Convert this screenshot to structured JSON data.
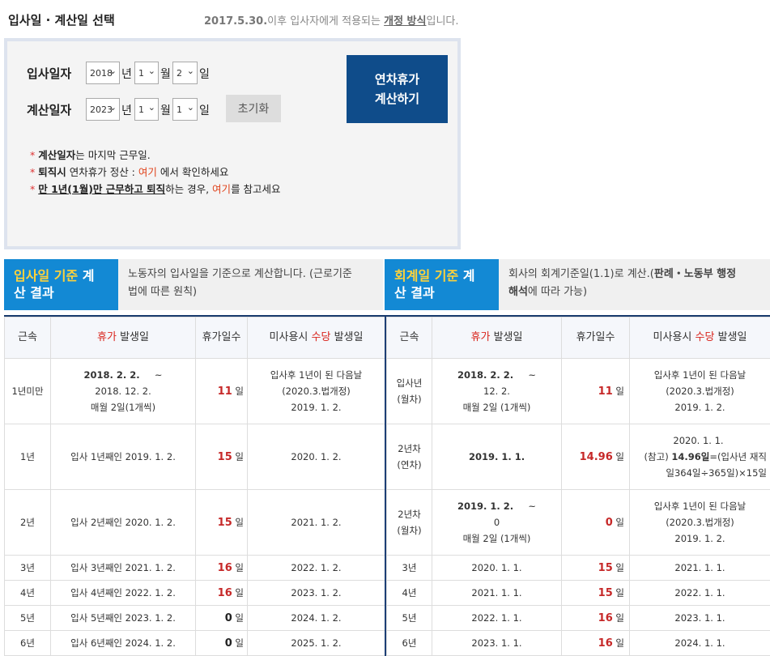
{
  "header": {
    "title": "입사일 · 계산일 선택",
    "notice_date": "2017.5.30.",
    "notice_mid": "이후 입사자에게 적용되는 ",
    "notice_link": "개정 방식",
    "notice_end": "입니다."
  },
  "form": {
    "hire_label": "입사일자",
    "calc_label": "계산일자",
    "hire": {
      "year": "2018",
      "month": "1",
      "day": "2"
    },
    "calc": {
      "year": "2023",
      "month": "1",
      "day": "1"
    },
    "unit_year": "년",
    "unit_month": "월",
    "unit_day": "일",
    "reset_label": "초기화",
    "calc_button_line1": "연차휴가",
    "calc_button_line2": "계산하기"
  },
  "notes": {
    "n1_bold": "계산일자",
    "n1_rest": "는 마지막 근무일.",
    "n2_bold": "퇴직시",
    "n2_mid": " 연차휴가 정산 : ",
    "n2_link": "여기",
    "n2_end": " 에서 확인하세요",
    "n3_bold": "만 1년(1월)만 근무하고 퇴직",
    "n3_mid": "하는 경우, ",
    "n3_link": "여기",
    "n3_end": "를 참고세요"
  },
  "tabs": {
    "left_line1_y": "입사일 기준",
    "left_line1_w": " 계",
    "left_line2": "산 결과",
    "left_desc1": "노동자의 입사일을 기준으로 계산합니다. (근로기준",
    "left_desc2": "법에 따른 원칙)",
    "right_line1_y": "회계일 기준",
    "right_line1_w": " 계",
    "right_line2": "산 결과",
    "right_desc1": "회사의 회계기준일(1.1)로 계산.(",
    "right_desc1_bold": "판례・노동부 행정",
    "right_desc2_bold": "해석",
    "right_desc2": "에 따라 가능)"
  },
  "table_headers": {
    "tenure": "근속",
    "leave_red": "휴가",
    "leave_rest": " 발생일",
    "days": "휴가일수",
    "unused_pre": "미사용시 ",
    "unused_red": "수당",
    "unused_post": " 발생일"
  },
  "left_rows": [
    {
      "tenure": "1년미만",
      "date_bold": "2018. 2. 2.",
      "date_tilde": "~",
      "date_l2": "2018. 12. 2.",
      "date_l3": "매월 2일(1개씩)",
      "days": "11",
      "unit": "일",
      "unused_l1": "입사후 1년이 된 다음날",
      "unused_l2": "(2020.3.법개정)",
      "unused_l3": "2019. 1. 2."
    },
    {
      "tenure": "1년",
      "date": "입사 1년째인 2019. 1. 2.",
      "days": "15",
      "unit": "일",
      "unused": "2020. 1. 2."
    },
    {
      "tenure": "2년",
      "date": "입사 2년째인 2020. 1. 2.",
      "days": "15",
      "unit": "일",
      "unused": "2021. 1. 2."
    },
    {
      "tenure": "3년",
      "date": "입사 3년째인 2021. 1. 2.",
      "days": "16",
      "unit": "일",
      "unused": "2022. 1. 2."
    },
    {
      "tenure": "4년",
      "date": "입사 4년째인 2022. 1. 2.",
      "days": "16",
      "unit": "일",
      "unused": "2023. 1. 2."
    },
    {
      "tenure": "5년",
      "date": "입사 5년째인 2023. 1. 2.",
      "days": "0",
      "unit": "일",
      "unused": "2024. 1. 2."
    },
    {
      "tenure": "6년",
      "date": "입사 6년째인 2024. 1. 2.",
      "days": "0",
      "unit": "일",
      "unused": "2025. 1. 2."
    }
  ],
  "right_rows": [
    {
      "tenure_l1": "입사년",
      "tenure_l2": "(월차)",
      "date_bold": "2018. 2. 2.",
      "date_tilde": "~",
      "date_l2": "12. 2.",
      "date_l3": "매월 2일 (1개씩)",
      "days": "11",
      "unit": "일",
      "unused_l1": "입사후 1년이 된 다음날",
      "unused_l2": "(2020.3.법개정)",
      "unused_l3": "2019. 1. 2."
    },
    {
      "tenure_l1": "2년차",
      "tenure_l2": "(연차)",
      "date_bold": "2019. 1. 1.",
      "days": "14.96",
      "unit": "일",
      "unused_l1": "2020. 1. 1.",
      "unused_l2_pre": "(참고) ",
      "unused_l2_bold": "14.96일",
      "unused_l2_post": "=(입사년 재직",
      "unused_l3": "일364일÷365일)×15일"
    },
    {
      "tenure_l1": "2년차",
      "tenure_l2": "(월차)",
      "date_bold": "2019. 1. 2.",
      "date_tilde": "~",
      "date_l2": "0",
      "date_l3": "매월 2일 (1개씩)",
      "days": "0",
      "unit": "일",
      "unused_l1": "입사후 1년이 된 다음날",
      "unused_l2": "(2020.3.법개정)",
      "unused_l3": "2019. 1. 2."
    },
    {
      "tenure": "3년",
      "date": "2020. 1. 1.",
      "days": "15",
      "unit": "일",
      "unused": "2021. 1. 1."
    },
    {
      "tenure": "4년",
      "date": "2021. 1. 1.",
      "days": "15",
      "unit": "일",
      "unused": "2022. 1. 1."
    },
    {
      "tenure": "5년",
      "date": "2022. 1. 1.",
      "days": "16",
      "unit": "일",
      "unused": "2023. 1. 1."
    },
    {
      "tenure": "6년",
      "date": "2023. 1. 1.",
      "days": "16",
      "unit": "일",
      "unused": "2024. 1. 1."
    }
  ],
  "colors": {
    "accent_blue": "#1389d4",
    "button_navy": "#0f4c8a",
    "highlight_red": "#c62828",
    "tab_yellow": "#ffd23a"
  }
}
